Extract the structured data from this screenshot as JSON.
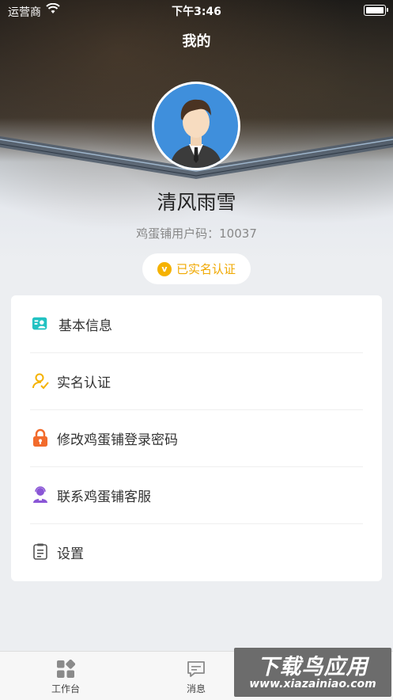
{
  "status_bar": {
    "carrier": "运营商",
    "time": "下午3:46"
  },
  "header": {
    "title": "我的"
  },
  "profile": {
    "name": "清风雨雪",
    "user_code": "鸡蛋铺用户码：10037",
    "verified_badge": {
      "icon": "v",
      "label": "已实名认证"
    }
  },
  "menu": {
    "items": [
      {
        "label": "基本信息",
        "icon": "profile-card-icon",
        "color": "#22c2c2"
      },
      {
        "label": "实名认证",
        "icon": "user-verify-icon",
        "color": "#f5b200"
      },
      {
        "label": "修改鸡蛋铺登录密码",
        "icon": "lock-icon",
        "color": "#f26b2c"
      },
      {
        "label": "联系鸡蛋铺客服",
        "icon": "customer-service-icon",
        "color": "#8a56d6"
      },
      {
        "label": "设置",
        "icon": "settings-list-icon",
        "color": "#555555"
      }
    ]
  },
  "tab_bar": {
    "tabs": [
      {
        "label": "工作台",
        "icon": "workbench-icon"
      },
      {
        "label": "消息",
        "icon": "message-icon"
      }
    ]
  },
  "watermark": {
    "title": "下载鸟应用",
    "url": "www.xiazainiao.com"
  }
}
